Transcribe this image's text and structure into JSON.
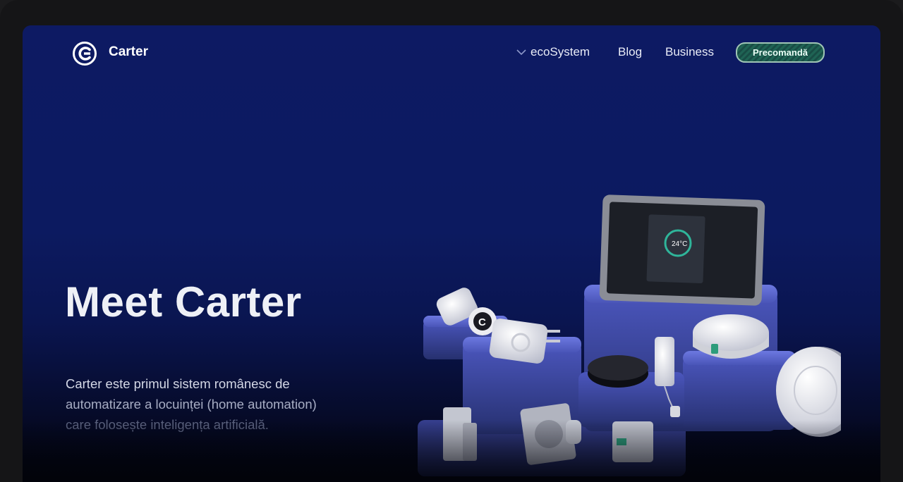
{
  "header": {
    "brand": "Carter",
    "nav": [
      {
        "label": "ecoSystem",
        "icon": "chevron-down-icon"
      },
      {
        "label": "Blog"
      },
      {
        "label": "Business"
      }
    ],
    "cta_label": "Precomandă"
  },
  "hero": {
    "title": "Meet Carter",
    "description_lines": [
      "Carter este primul sistem românesc de",
      "automatizare a locuinței (home automation)",
      "care folosește inteligența artificială."
    ]
  },
  "colors": {
    "background": "#0c1a60",
    "cta_border": "#9fc5b5",
    "cta_fill": "#1f6354",
    "pedestal": "#5560c7"
  }
}
